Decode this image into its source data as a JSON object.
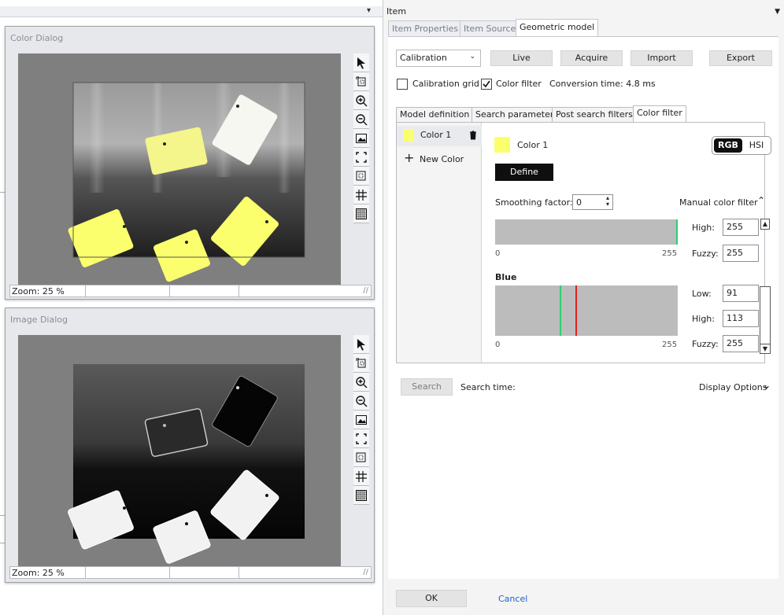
{
  "left_pane": {
    "menu_arrow": "▾"
  },
  "color_dialog": {
    "title": "Color Dialog",
    "zoom": "Zoom: 25 %"
  },
  "image_dialog": {
    "title": "Image Dialog",
    "zoom": "Zoom: 25 %"
  },
  "toolbar_icons": [
    "pointer-icon",
    "crop-icon",
    "zoom-in-icon",
    "zoom-out-icon",
    "image-icon",
    "fit-icon",
    "region-icon",
    "grid-icon",
    "fine-grid-icon"
  ],
  "item_panel": {
    "title": "Item",
    "tabs": [
      "Item Properties",
      "Item Source",
      "Geometric model"
    ],
    "active_tab": "Geometric model",
    "mode_select": "Calibration",
    "buttons": {
      "live": "Live",
      "acquire": "Acquire",
      "import": "Import",
      "export": "Export"
    },
    "calibration_grid": {
      "label": "Calibration grid",
      "checked": false
    },
    "color_filter": {
      "label": "Color filter",
      "checked": true
    },
    "conversion_time": "Conversion time: 4.8 ms",
    "sub_tabs": [
      "Model definition",
      "Search parameter",
      "Post search filters",
      "Color filter"
    ],
    "active_sub_tab": "Color filter",
    "colors": [
      {
        "name": "Color 1",
        "swatch": "#fcff6d"
      }
    ],
    "new_color": "New Color",
    "selected_color": "Color 1",
    "mode_toggle": {
      "rgb": "RGB",
      "hsi": "HSI",
      "active": "RGB"
    },
    "define_label": "Define",
    "smoothing_label": "Smoothing factor:",
    "smoothing_value": "0",
    "manual_filter_label": "Manual color filter",
    "channels": [
      {
        "name": "",
        "high_label": "High:",
        "high": "255",
        "fuzzy_label": "Fuzzy:",
        "fuzzy": "255",
        "markers": [
          {
            "value": 255,
            "color": "#2ecc71"
          }
        ],
        "min": "0",
        "max": "255"
      },
      {
        "name": "Blue",
        "low_label": "Low:",
        "low": "91",
        "high_label": "High:",
        "high": "113",
        "fuzzy_label": "Fuzzy:",
        "fuzzy": "255",
        "markers": [
          {
            "value": 91,
            "color": "#2ecc71"
          },
          {
            "value": 113,
            "color": "#e02020"
          }
        ],
        "min": "0",
        "max": "255"
      }
    ],
    "search_label": "Search",
    "search_time": "Search time:",
    "display_options": "Display Options",
    "ok": "OK",
    "cancel": "Cancel"
  },
  "colors": {
    "accent_black": "#000000",
    "tag_yellow": "#fcff6d",
    "link_blue": "#1f5fd0",
    "viewport_gray": "#7f7f7f"
  }
}
